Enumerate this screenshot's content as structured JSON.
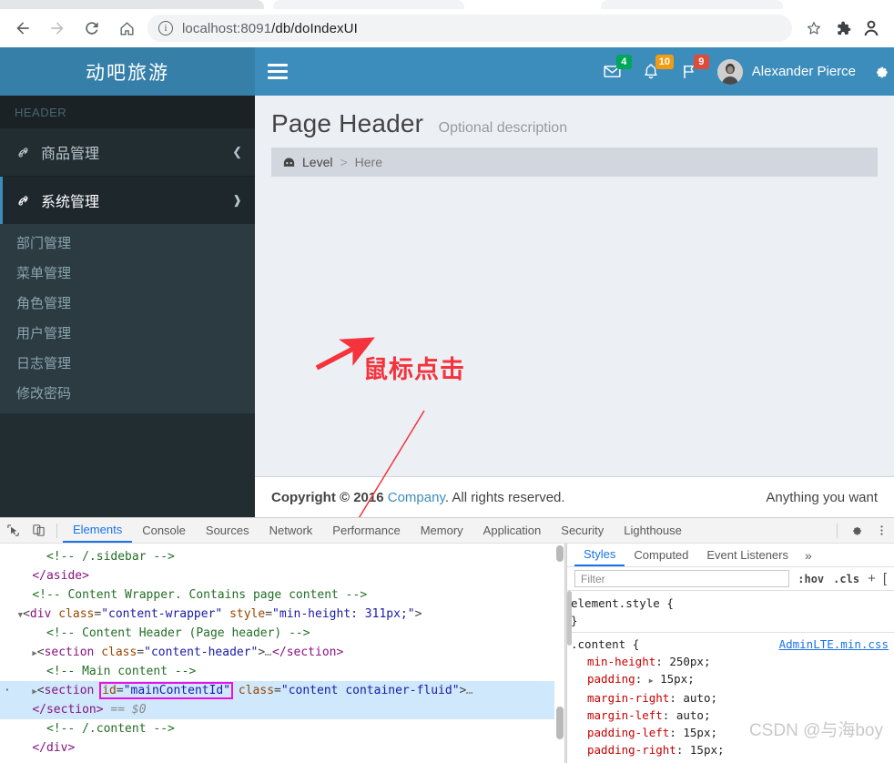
{
  "browser": {
    "url_protocol_host": "localhost:8091",
    "url_path": "/db/doIndexUI",
    "url_full": "localhost:8091/db/doIndexUI",
    "back_icon": "back-arrow-icon",
    "forward_icon": "forward-arrow-icon",
    "reload_icon": "reload-icon",
    "home_icon": "home-icon",
    "info_icon": "page-info-icon",
    "bookmark_icon": "star-icon",
    "extensions_icon": "puzzle-piece-icon",
    "profile_icon": "profile-avatar-icon"
  },
  "app": {
    "logo": "动吧旅游",
    "navbar": {
      "toggle_icon": "hamburger-icon",
      "messages": {
        "icon": "envelope-icon",
        "count": "4",
        "color": "#00a65a"
      },
      "notifications": {
        "icon": "bell-icon",
        "count": "10",
        "color": "#f39c12"
      },
      "tasks": {
        "icon": "flag-icon",
        "count": "9",
        "color": "#dd4b39"
      },
      "user_name": "Alexander Pierce",
      "settings_icon": "gear-icon"
    },
    "sidebar": {
      "header": "HEADER",
      "items": [
        {
          "label": "商品管理",
          "icon": "link-icon",
          "arrow": "chevron-left-icon",
          "open": false
        },
        {
          "label": "系统管理",
          "icon": "link-icon",
          "arrow": "chevron-down-icon",
          "open": true
        }
      ],
      "submenu": [
        {
          "label": "部门管理"
        },
        {
          "label": "菜单管理"
        },
        {
          "label": "角色管理"
        },
        {
          "label": "用户管理"
        },
        {
          "label": "日志管理"
        },
        {
          "label": "修改密码"
        }
      ]
    },
    "content": {
      "page_title": "Page Header",
      "page_description": "Optional description",
      "breadcrumb": {
        "home_icon": "dashboard-icon",
        "level": "Level",
        "separator": ">",
        "current": "Here"
      },
      "annotation": "鼠标点击"
    },
    "footer": {
      "copyright_prefix": "Copyright © 2016 ",
      "company": "Company",
      "copyright_suffix": ". All rights reserved.",
      "right": "Anything you want"
    },
    "colors": {
      "navbar": "#3c8dbc",
      "logo": "#367fa9",
      "sidebar": "#222d32",
      "sidebar_active": "#1e282c",
      "submenu": "#2c3b41",
      "content_bg": "#ecf0f5",
      "breadcrumb_bg": "#d2d6de",
      "annotation_red": "#f4333c",
      "highlight_pink": "#e80fe8"
    }
  },
  "devtools": {
    "inspect_icon": "inspect-cursor-icon",
    "device_icon": "device-toolbar-icon",
    "tabs": [
      {
        "label": "Elements",
        "active": true
      },
      {
        "label": "Console",
        "active": false
      },
      {
        "label": "Sources",
        "active": false
      },
      {
        "label": "Network",
        "active": false
      },
      {
        "label": "Performance",
        "active": false
      },
      {
        "label": "Memory",
        "active": false
      },
      {
        "label": "Application",
        "active": false
      },
      {
        "label": "Security",
        "active": false
      },
      {
        "label": "Lighthouse",
        "active": false
      }
    ],
    "settings_icon": "gear-icon",
    "more_icon": "kebab-menu-icon",
    "dom": [
      {
        "indent": 3,
        "type": "comment",
        "text": "<!-- /.sidebar -->"
      },
      {
        "indent": 2,
        "type": "tag",
        "text": "</aside>"
      },
      {
        "indent": 2,
        "type": "comment",
        "text": "<!-- Content Wrapper. Contains page content -->"
      },
      {
        "indent": 1,
        "type": "element",
        "triangle": "▼",
        "tag": "div",
        "attrs": "class=\"content-wrapper\" style=\"min-height: 311px;\""
      },
      {
        "indent": 3,
        "type": "comment",
        "text": "<!-- Content Header (Page header) -->"
      },
      {
        "indent": 2,
        "type": "element",
        "triangle": "▶",
        "tag": "section",
        "attrs": "class=\"content-header\"",
        "tail": "…</section>"
      },
      {
        "indent": 3,
        "type": "comment",
        "text": "<!-- Main content -->"
      },
      {
        "indent": 2,
        "type": "selected",
        "triangle": "▶",
        "tag": "section",
        "id_attr": "id=\"mainContentId\"",
        "attrs": "class=\"content container-fluid\"",
        "tail": "…"
      },
      {
        "indent": 2,
        "type": "selected-close",
        "text": "</section>",
        "marker": "== $0"
      },
      {
        "indent": 3,
        "type": "comment",
        "text": "<!-- /.content -->"
      },
      {
        "indent": 2,
        "type": "tag",
        "text": "</div>"
      }
    ],
    "styles": {
      "tabs": [
        {
          "label": "Styles",
          "active": true
        },
        {
          "label": "Computed",
          "active": false
        },
        {
          "label": "Event Listeners",
          "active": false
        }
      ],
      "more": "»",
      "filter_placeholder": "Filter",
      "hov": ":hov",
      "cls": ".cls",
      "plus": "+",
      "rules": [
        {
          "selector": "element.style {",
          "source": "",
          "declarations": [],
          "close": "}"
        },
        {
          "selector": ".content {",
          "source": "AdminLTE.min.css",
          "declarations": [
            {
              "prop": "min-height",
              "value": "250px;"
            },
            {
              "prop": "padding",
              "value": "15px;",
              "expandable": true
            },
            {
              "prop": "margin-right",
              "value": "auto;"
            },
            {
              "prop": "margin-left",
              "value": "auto;"
            },
            {
              "prop": "padding-left",
              "value": "15px;"
            },
            {
              "prop": "padding-right",
              "value": "15px;"
            }
          ],
          "close": ""
        }
      ],
      "watermark": "CSDN @与海boy"
    }
  }
}
